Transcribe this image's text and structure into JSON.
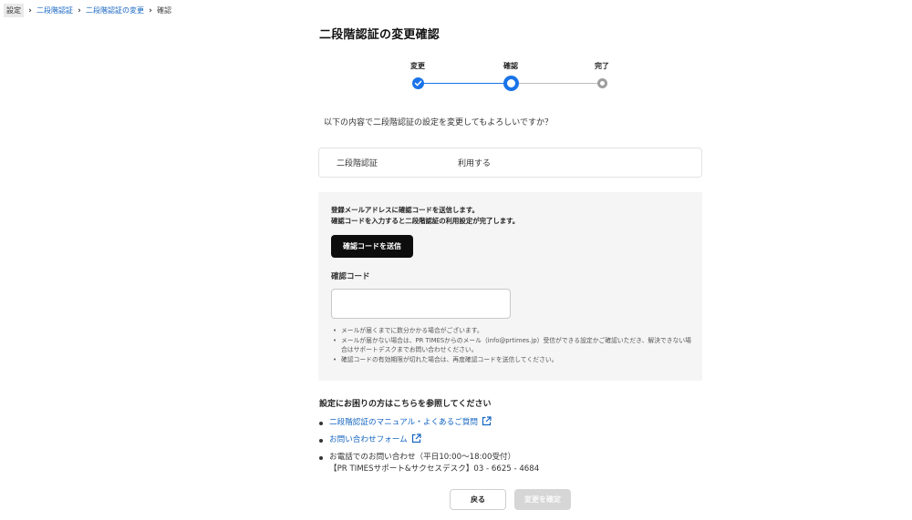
{
  "breadcrumb": {
    "first": "設定",
    "link1": "二段階認証",
    "link2": "二段階認証の変更",
    "current": "確認"
  },
  "title": "二段階認証の変更確認",
  "stepper": {
    "steps": [
      {
        "label": "変更",
        "state": "done"
      },
      {
        "label": "確認",
        "state": "current"
      },
      {
        "label": "完了",
        "state": "todo"
      }
    ]
  },
  "question": "以下の内容で二段階認証の設定を変更してもよろしいですか？",
  "summary": {
    "key": "二段階認証",
    "value": "利用する"
  },
  "verification": {
    "desc_line1": "登録メールアドレスに確認コードを送信します。",
    "desc_line2": "確認コードを入力すると二段階認証の利用設定が完了します。",
    "send_button": "確認コードを送信",
    "code_label": "確認コード",
    "code_value": "",
    "notes": [
      "メールが届くまでに数分かかる場合がございます。",
      "メールが届かない場合は、PR TIMESからのメール（info@prtimes.jp）受信ができる設定かご確認いただき、解決できない場合はサポートデスクまでお問い合わせください。",
      "確認コードの有効期限が切れた場合は、再度確認コードを送信してください。"
    ]
  },
  "help": {
    "title": "設定にお困りの方はこちらを参照してください",
    "link_manual": "二段階認証のマニュアル・よくあるご質問",
    "link_form": "お問い合わせフォーム",
    "phone_line1": "お電話でのお問い合わせ（平日10:00〜18:00受付）",
    "phone_line2": "【PR TIMESサポート&サクセスデスク】03 - 6625 - 4684"
  },
  "footer": {
    "back_label": "戻る",
    "confirm_label": "変更を確定"
  },
  "colors": {
    "accent": "#1a73e8",
    "link": "#1565c0",
    "inactive": "#9e9e9e"
  },
  "icons": [
    "check-icon",
    "external-link-icon",
    "chevron-right-icon"
  ]
}
